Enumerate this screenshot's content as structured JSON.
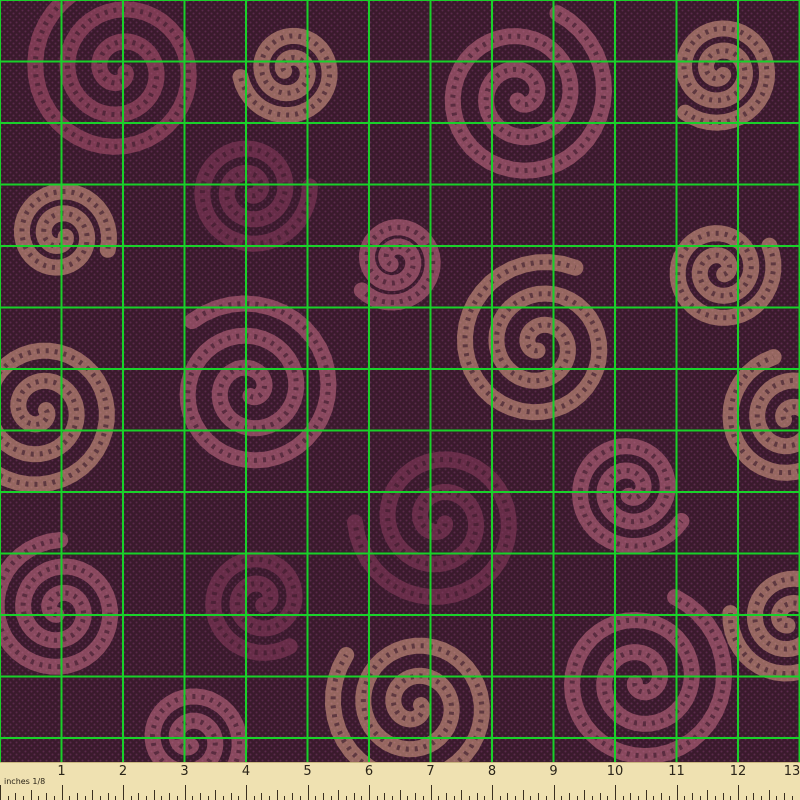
{
  "fabric": {
    "background": "#3a1a2c",
    "weave_dot": "#5b2a4c",
    "grid_color": "#19d12a",
    "swirl_colors": [
      "#c96f86",
      "#e0a58a",
      "#b35672",
      "#8a3c5e"
    ]
  },
  "ruler": {
    "background": "#efe1b1",
    "unit_caption": "inches 1/8",
    "labels": [
      "1",
      "2",
      "3",
      "4",
      "5",
      "6",
      "7",
      "8",
      "9",
      "10",
      "11",
      "12",
      "13"
    ]
  }
}
